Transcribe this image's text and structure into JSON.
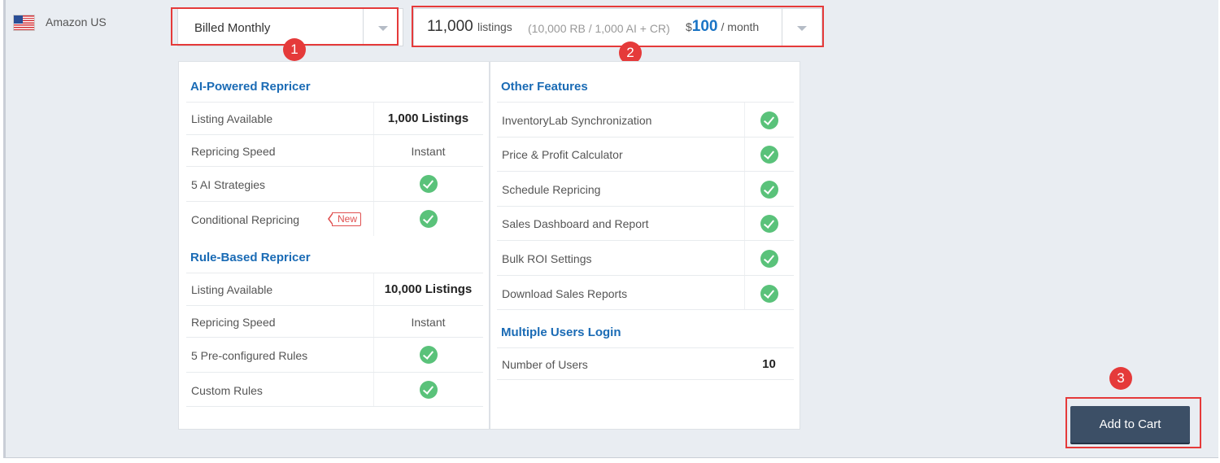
{
  "marketplace": {
    "label": "Amazon US",
    "flag_icon": "us-flag-icon"
  },
  "billing": {
    "selected": "Billed Monthly"
  },
  "plan": {
    "count": "11,000",
    "unit": "listings",
    "detail": "(10,000 RB / 1,000 AI + CR)",
    "currency": "$",
    "amount": "100",
    "period": "/ month"
  },
  "annotations": [
    "1",
    "2",
    "3"
  ],
  "ai_repricer": {
    "title": "AI-Powered Repricer",
    "rows": [
      {
        "label": "Listing Available",
        "value": "1,000 Listings"
      },
      {
        "label": "Repricing Speed",
        "value": "Instant"
      },
      {
        "label": "5 AI Strategies",
        "check": true
      },
      {
        "label": "Conditional Repricing",
        "tag": "New",
        "check": true
      }
    ]
  },
  "rule_repricer": {
    "title": "Rule-Based Repricer",
    "rows": [
      {
        "label": "Listing Available",
        "value": "10,000 Listings"
      },
      {
        "label": "Repricing Speed",
        "value": "Instant"
      },
      {
        "label": "5 Pre-configured Rules",
        "check": true
      },
      {
        "label": "Custom Rules",
        "check": true
      }
    ]
  },
  "other_features": {
    "title": "Other Features",
    "rows": [
      {
        "label": "InventoryLab Synchronization",
        "check": true
      },
      {
        "label": "Price & Profit Calculator",
        "check": true
      },
      {
        "label": "Schedule Repricing",
        "check": true
      },
      {
        "label": "Sales Dashboard and Report",
        "check": true
      },
      {
        "label": "Bulk ROI Settings",
        "check": true
      },
      {
        "label": "Download Sales Reports",
        "check": true
      }
    ]
  },
  "multi_users": {
    "title": "Multiple Users Login",
    "rows": [
      {
        "label": "Number of Users",
        "value": "10"
      }
    ]
  },
  "colors": {
    "accent": "#1a6bb5",
    "check": "#5ac27a",
    "highlight": "#e53a3a",
    "button": "#3c4f66"
  },
  "cart": {
    "label": "Add to Cart"
  }
}
